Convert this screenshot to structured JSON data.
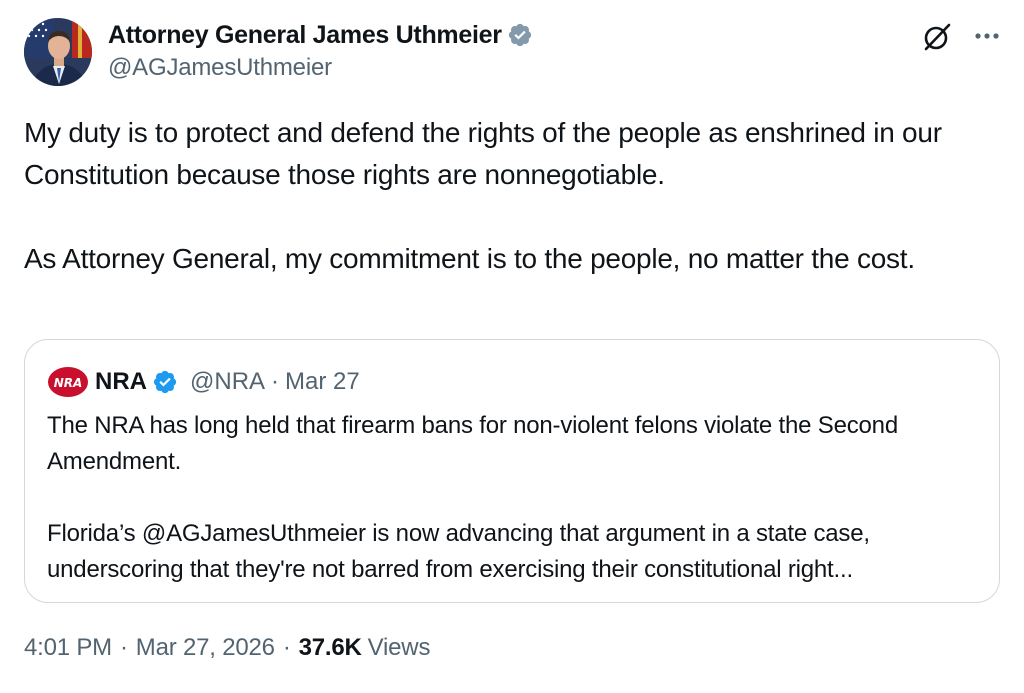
{
  "author": {
    "display_name": "Attorney General James Uthmeier",
    "handle": "@AGJamesUthmeier"
  },
  "icons": {
    "verified": "verified-badge-grey",
    "grok": "grok-icon",
    "more": "more-options-icon"
  },
  "tweet": {
    "paragraphs": [
      "My duty is to protect and defend the rights of the people as enshrined in our Constitution because those rights are nonnegotiable.",
      "As Attorney General, my commitment is to the people, no matter the cost."
    ]
  },
  "quoted": {
    "logo_text": "NRA",
    "display_name": "NRA",
    "handle": "@NRA",
    "separator": "·",
    "date": "Mar 27",
    "paragraphs": [
      "The NRA has long held that firearm bans for non-violent felons violate the Second Amendment.",
      "Florida’s @AGJamesUthmeier is now advancing that argument in a state case, underscoring that they're not barred from exercising their constitutional right..."
    ]
  },
  "meta": {
    "time": "4:01 PM",
    "separator": "·",
    "date": "Mar 27, 2026",
    "views_count": "37.6K",
    "views_label": "Views"
  },
  "colors": {
    "text": "#0f1419",
    "secondary": "#536471",
    "border": "#cfd9de",
    "verified_blue": "#1d9bf0",
    "verified_grey": "#829aab",
    "nra_red": "#c8102e"
  }
}
